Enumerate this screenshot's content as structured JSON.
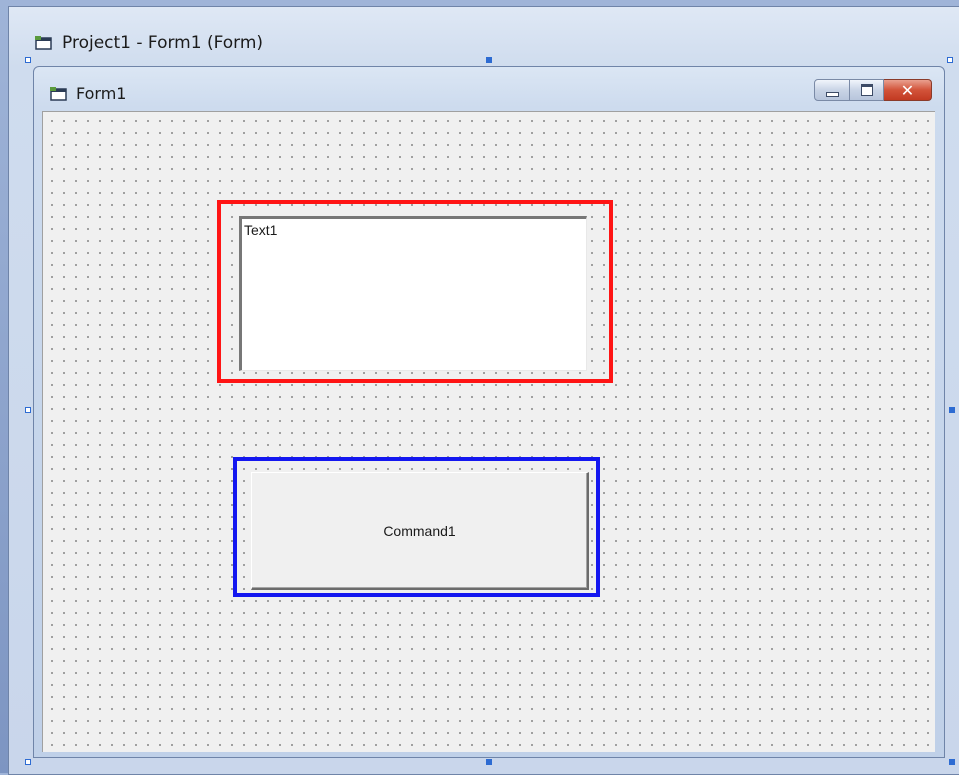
{
  "outer_window": {
    "title": "Project1 - Form1 (Form)",
    "icon": "form-icon"
  },
  "form": {
    "title": "Form1",
    "icon": "form-icon",
    "caption_buttons": {
      "minimize": "minimize-icon",
      "maximize": "maximize-icon",
      "close_glyph": "✕"
    }
  },
  "controls": {
    "textbox": {
      "text": "Text1",
      "highlight_color": "#ff1414"
    },
    "command_button": {
      "caption": "Command1",
      "highlight_color": "#1417f0"
    }
  },
  "colors": {
    "selection_handle": "#2d6bd2",
    "close_button": "#d2533a"
  }
}
